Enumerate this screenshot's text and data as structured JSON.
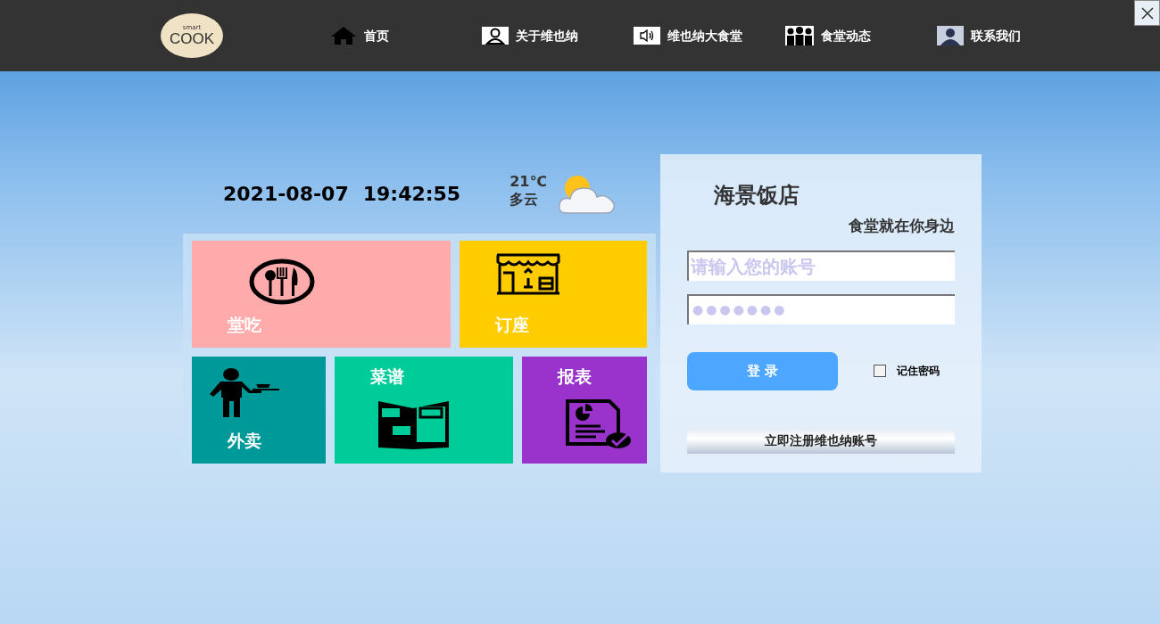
{
  "logo": {
    "top": "smart",
    "main": "COOK"
  },
  "nav": [
    {
      "label": "首页",
      "kind": "home"
    },
    {
      "label": "关于维也纳",
      "kind": "person"
    },
    {
      "label": "维也纳大食堂",
      "kind": "speaker"
    },
    {
      "label": "食堂动态",
      "kind": "group"
    },
    {
      "label": "联系我们",
      "kind": "photo"
    }
  ],
  "datetime": {
    "date": "2021-08-07",
    "time": "19:42:55"
  },
  "weather": {
    "temp": "21℃",
    "desc": "多云"
  },
  "tiles": [
    {
      "label": "堂吃",
      "kind": "dine",
      "color": "#ffabab"
    },
    {
      "label": "订座",
      "kind": "shop",
      "color": "#ffcc00"
    },
    {
      "label": "外卖",
      "kind": "waiter",
      "color": "#009999"
    },
    {
      "label": "菜谱",
      "kind": "menu",
      "color": "#00cc99"
    },
    {
      "label": "报表",
      "kind": "report",
      "color": "#9933cc"
    }
  ],
  "login": {
    "title": "海景饭店",
    "slogan": "食堂就在你身边",
    "account": {
      "placeholder": "请输入您的账号"
    },
    "password": {
      "value": "●●●●●●●"
    },
    "submit": "登 录",
    "remember": {
      "label": "记住密码",
      "checked": false
    },
    "register": "立即注册维也纳账号"
  }
}
